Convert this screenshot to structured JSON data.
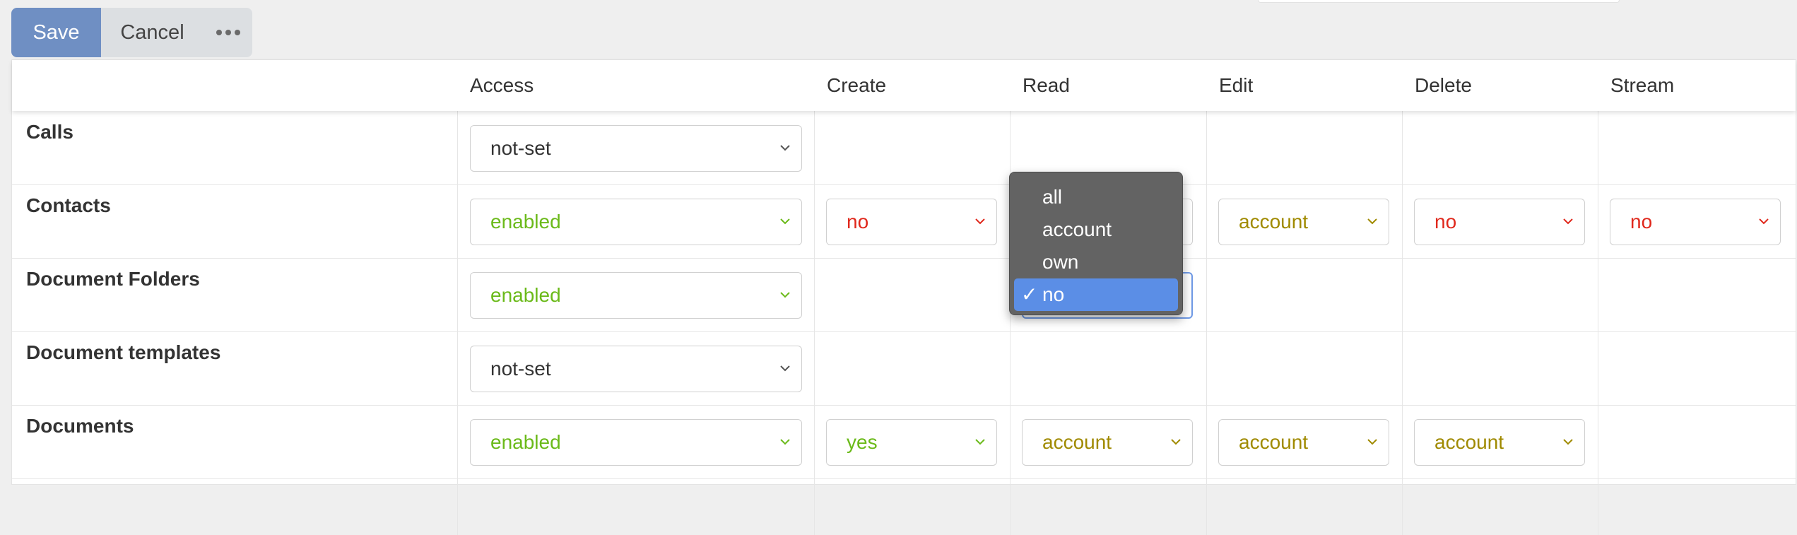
{
  "toolbar": {
    "save_label": "Save",
    "cancel_label": "Cancel",
    "more_icon": "ellipsis-icon"
  },
  "columns": [
    "Access",
    "Create",
    "Read",
    "Edit",
    "Delete",
    "Stream"
  ],
  "rows": [
    {
      "label": "Calls",
      "access": "not-set"
    },
    {
      "label": "Contacts",
      "access": "enabled",
      "create": "no",
      "edit": "account",
      "delete": "no",
      "stream": "no"
    },
    {
      "label": "Document Folders",
      "access": "enabled"
    },
    {
      "label": "Document templates",
      "access": "not-set"
    },
    {
      "label": "Documents",
      "access": "enabled",
      "create": "yes",
      "read": "account",
      "edit": "account",
      "delete": "account"
    }
  ],
  "dropdown": {
    "options": [
      "all",
      "account",
      "own",
      "no"
    ],
    "selected": "no"
  },
  "colors": {
    "enabled": "#6bba1a",
    "no": "#e0291d",
    "account": "#a08a00",
    "selected_option": "#5b8ee6",
    "save_button": "#6f8fc3"
  }
}
